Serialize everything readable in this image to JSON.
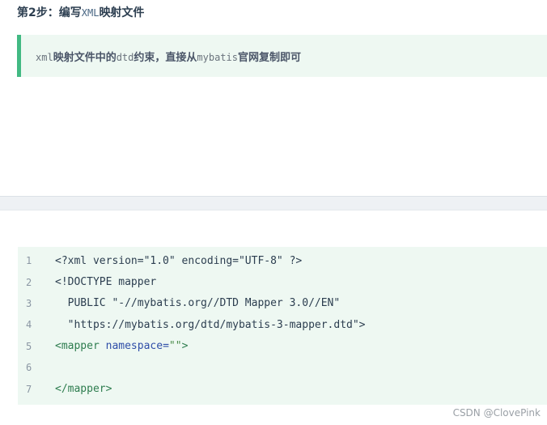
{
  "heading": {
    "prefix": "第2步：编写",
    "code": "XML",
    "suffix": "映射文件"
  },
  "tip": {
    "code1": "xml",
    "text1": "映射文件中的",
    "code2": "dtd",
    "text2": "约束，直接从",
    "code3": "mybatis",
    "text3": "官网复制即可"
  },
  "code_block": {
    "lines": [
      {
        "num": "1",
        "text": "<?xml version=\"1.0\" encoding=\"UTF-8\" ?>"
      },
      {
        "num": "2",
        "text": "<!DOCTYPE mapper"
      },
      {
        "num": "3",
        "text": "  PUBLIC \"-//mybatis.org//DTD Mapper 3.0//EN\""
      },
      {
        "num": "4",
        "text": "  \"https://mybatis.org/dtd/mybatis-3-mapper.dtd\">"
      },
      {
        "num": "5",
        "tag_open": "<mapper",
        "attr": " namespace",
        "eq": "=",
        "str": "\"\"",
        "tag_close": ">"
      },
      {
        "num": "6",
        "text": ""
      },
      {
        "num": "7",
        "tag": "</mapper>"
      }
    ]
  },
  "watermark": "CSDN @ClovePink"
}
